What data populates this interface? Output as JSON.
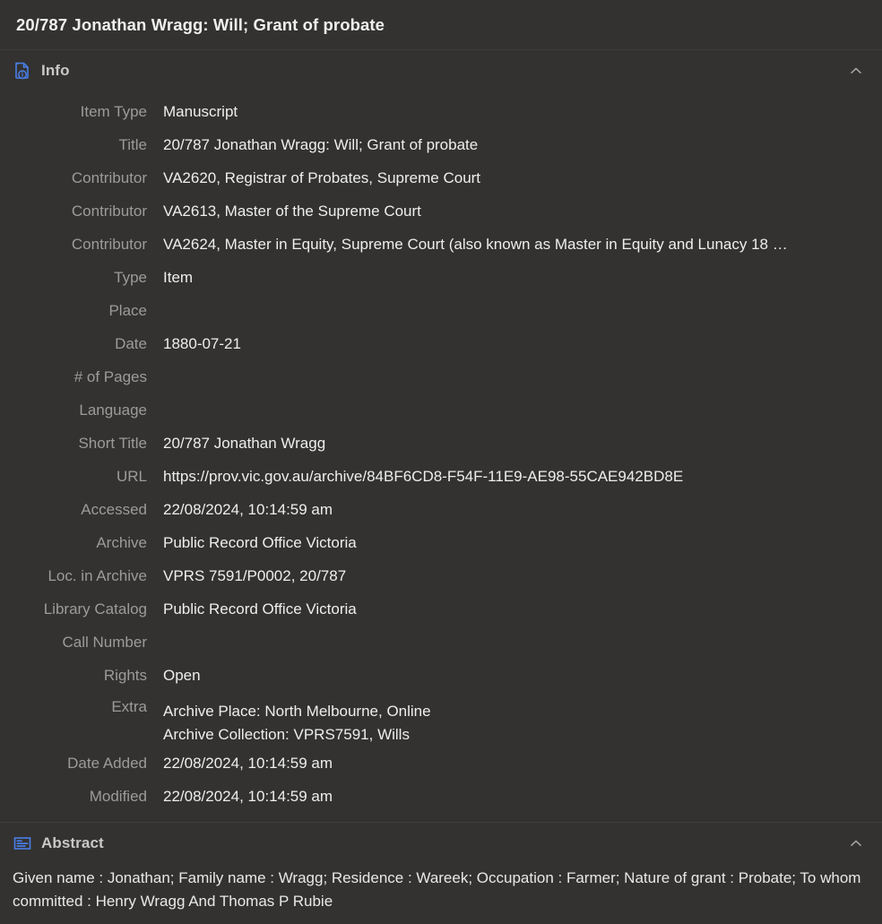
{
  "item": {
    "title": "20/787 Jonathan Wragg: Will; Grant of probate"
  },
  "sections": {
    "info": {
      "label": "Info",
      "icon": "document-info-icon",
      "collapse_icon": "chevron-up-icon",
      "fields": [
        {
          "label": "Item Type",
          "value": "Manuscript"
        },
        {
          "label": "Title",
          "value": "20/787 Jonathan Wragg: Will; Grant of probate"
        },
        {
          "label": "Contributor",
          "value": "VA2620, Registrar of Probates, Supreme Court"
        },
        {
          "label": "Contributor",
          "value": "VA2613, Master of the Supreme Court"
        },
        {
          "label": "Contributor",
          "value": "VA2624, Master in Equity, Supreme Court (also known as Master in Equity and Lunacy 18 …"
        },
        {
          "label": "Type",
          "value": "Item"
        },
        {
          "label": "Place",
          "value": ""
        },
        {
          "label": "Date",
          "value": "1880-07-21"
        },
        {
          "label": "# of Pages",
          "value": ""
        },
        {
          "label": "Language",
          "value": ""
        },
        {
          "label": "Short Title",
          "value": "20/787 Jonathan Wragg"
        },
        {
          "label": "URL",
          "value": "https://prov.vic.gov.au/archive/84BF6CD8-F54F-11E9-AE98-55CAE942BD8E"
        },
        {
          "label": "Accessed",
          "value": "22/08/2024, 10:14:59 am"
        },
        {
          "label": "Archive",
          "value": "Public Record Office Victoria"
        },
        {
          "label": "Loc. in Archive",
          "value": "VPRS 7591/P0002, 20/787"
        },
        {
          "label": "Library Catalog",
          "value": "Public Record Office Victoria"
        },
        {
          "label": "Call Number",
          "value": ""
        },
        {
          "label": "Rights",
          "value": "Open"
        }
      ],
      "extra": {
        "label": "Extra",
        "line1": "Archive Place: North Melbourne, Online",
        "line2": "Archive Collection: VPRS7591, Wills"
      },
      "trailing_fields": [
        {
          "label": "Date Added",
          "value": "22/08/2024, 10:14:59 am"
        },
        {
          "label": "Modified",
          "value": "22/08/2024, 10:14:59 am"
        }
      ]
    },
    "abstract": {
      "label": "Abstract",
      "icon": "abstract-lines-icon",
      "collapse_icon": "chevron-up-icon",
      "text": "Given name : Jonathan; Family name : Wragg; Residence : Wareek; Occupation : Farmer; Nature of grant : Probate; To whom committed : Henry Wragg And Thomas P Rubie"
    }
  },
  "colors": {
    "background": "#333231",
    "accent": "#4a7ee8",
    "label": "#9c9b9a",
    "value": "#eeeeee",
    "divider": "#3f3e3d"
  }
}
